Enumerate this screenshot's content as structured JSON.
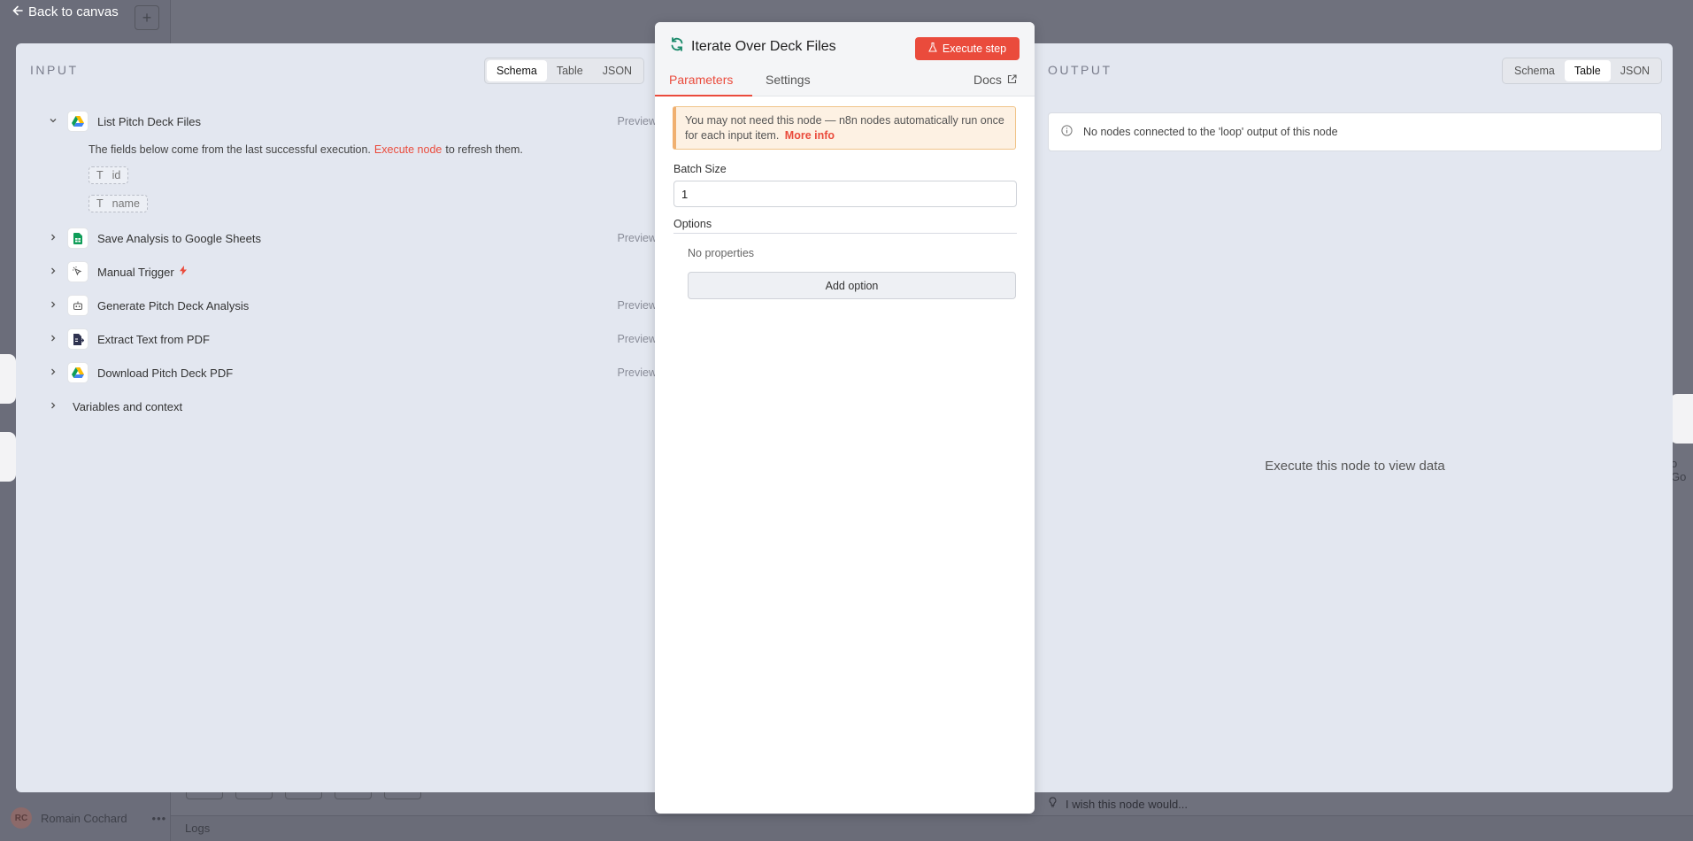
{
  "background": {
    "user_name": "Romain Cochard",
    "user_initials": "RC",
    "logs_label": "Logs",
    "feedback": "I wish this node would...",
    "right_node_text": "o Go"
  },
  "nav": {
    "back_label": "Back to canvas"
  },
  "input": {
    "header": "INPUT",
    "view_tabs": [
      "Schema",
      "Table",
      "JSON"
    ],
    "active_tab": "Schema",
    "nodes": [
      {
        "label": "List Pitch Deck Files",
        "preview": "Preview",
        "icon": "google-drive-icon",
        "expanded": true
      },
      {
        "label": "Save Analysis to Google Sheets",
        "preview": "Preview",
        "icon": "google-sheets-icon"
      },
      {
        "label": "Manual Trigger",
        "preview": "",
        "icon": "cursor-icon"
      },
      {
        "label": "Generate Pitch Deck Analysis",
        "preview": "Preview",
        "icon": "robot-icon"
      },
      {
        "label": "Extract Text from PDF",
        "preview": "Preview",
        "icon": "file-extract-icon"
      },
      {
        "label": "Download Pitch Deck PDF",
        "preview": "Preview",
        "icon": "google-drive-icon"
      }
    ],
    "hint_before": "The fields below come from the last successful execution.",
    "hint_link": "Execute node",
    "hint_after": "to refresh them.",
    "fields": [
      {
        "type": "T",
        "name": "id"
      },
      {
        "type": "T",
        "name": "name"
      }
    ],
    "vars_label": "Variables and context"
  },
  "node": {
    "title": "Iterate Over Deck Files",
    "execute_label": "Execute step",
    "tabs": [
      "Parameters",
      "Settings"
    ],
    "docs_label": "Docs",
    "notice_text": "You may not need this node — n8n nodes automatically run once for each input item.",
    "notice_link": "More info",
    "batch_label": "Batch Size",
    "batch_value": "1",
    "options_label": "Options",
    "no_properties": "No properties",
    "add_option": "Add option"
  },
  "output": {
    "header": "OUTPUT",
    "view_tabs": [
      "Schema",
      "Table",
      "JSON"
    ],
    "active_tab": "Table",
    "info": "No nodes connected to the 'loop' output of this node",
    "empty": "Execute this node to view data"
  },
  "colors": {
    "accent": "#ea4b3c",
    "notice_bg": "#fdf1e3",
    "panel_bg": "#e3e7f0"
  }
}
